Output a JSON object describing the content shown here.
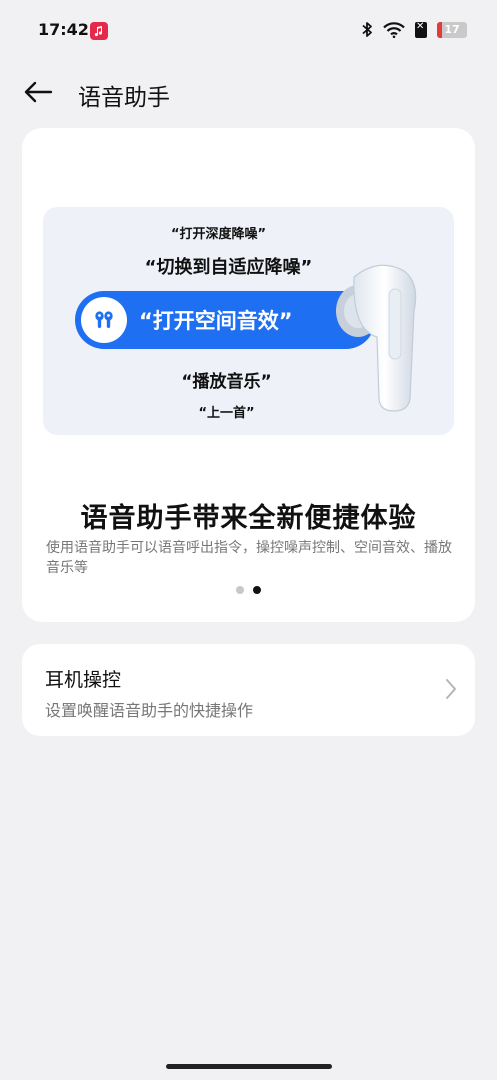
{
  "status_bar": {
    "time": "17:42",
    "battery_level": "17",
    "icons": [
      "music-app-icon",
      "bluetooth-icon",
      "wifi-icon",
      "no-sim-icon",
      "battery-icon"
    ]
  },
  "header": {
    "title": "语音助手",
    "back_icon": "arrow-left-icon"
  },
  "hero": {
    "illustration": {
      "phrase_1": "“打开深度降噪”",
      "phrase_2": "“切换到自适应降噪”",
      "highlighted_phrase": "“打开空间音效”",
      "phrase_4": "“播放音乐”",
      "phrase_5": "“上一首”"
    },
    "heading": "语音助手带来全新便捷体验",
    "description": "使用语音助手可以语音呼出指令，操控噪声控制、空间音效、播放音乐等",
    "pagination": {
      "total": 2,
      "active": 2
    }
  },
  "settings": {
    "earphone_control": {
      "title": "耳机操控",
      "subtitle": "设置唤醒语音助手的快捷操作"
    }
  },
  "colors": {
    "background": "#f1f1f3",
    "card": "#ffffff",
    "accent_blue": "#1f6ff2",
    "music_badge": "#e5294b",
    "battery_low": "#e23b3b"
  }
}
